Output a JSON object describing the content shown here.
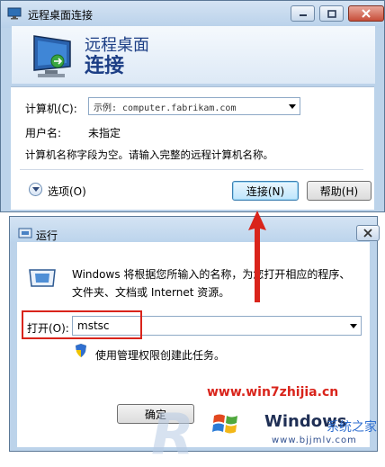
{
  "rdc": {
    "window_title": "远程桌面连接",
    "banner_line1": "远程桌面",
    "banner_line2": "连接",
    "computer_label": "计算机(C):",
    "computer_placeholder": "示例: computer.fabrikam.com",
    "user_label": "用户名:",
    "user_value": "未指定",
    "message": "计算机名称字段为空。请输入完整的远程计算机名称。",
    "options_label": "选项(O)",
    "connect_button": "连接(N)",
    "help_button": "帮助(H)"
  },
  "run": {
    "window_title": "运行",
    "description_line1": "Windows 将根据您所输入的名称，为您打开相应的程序、",
    "description_line2": "文件夹、文档或 Internet 资源。",
    "open_label": "打开(O):",
    "open_value": "mstsc",
    "admin_note": "使用管理权限创建此任务。",
    "ok_button": "确定"
  },
  "watermark": {
    "url": "www.win7zhijia.cn",
    "brand": "Windows",
    "brand_suffix": "系统之家",
    "site": "www.bjjmlv.com"
  },
  "colors": {
    "annotation_red": "#d9241b",
    "title_blue": "#1c3e85"
  }
}
